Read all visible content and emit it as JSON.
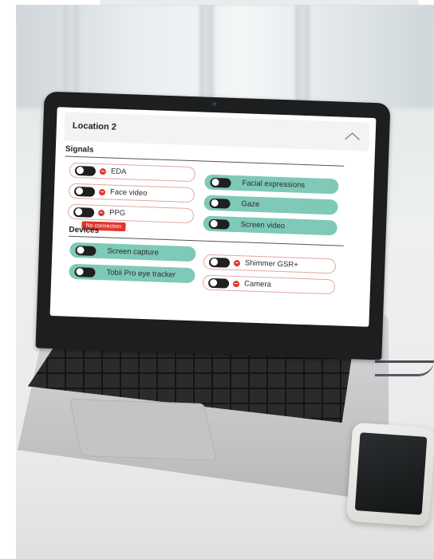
{
  "panel": {
    "title": "Location 2",
    "collapse_icon": "chevron-up-icon"
  },
  "signals": {
    "title": "Signals",
    "items": [
      {
        "label": "EDA",
        "enabled": false,
        "status": "error"
      },
      {
        "label": "Face video",
        "enabled": false,
        "status": "error"
      },
      {
        "label": "PPG",
        "enabled": false,
        "status": "error"
      },
      {
        "label": "Facial expressions",
        "enabled": true
      },
      {
        "label": "Gaze",
        "enabled": true
      },
      {
        "label": "Screen video",
        "enabled": true
      }
    ],
    "tooltip": "No connection"
  },
  "devices": {
    "title": "Devices",
    "items": [
      {
        "label": "Screen capture",
        "enabled": true
      },
      {
        "label": "Tobii Pro eye tracker",
        "enabled": true
      },
      {
        "label": "Shimmer GSR+",
        "enabled": false,
        "status": "error"
      },
      {
        "label": "Camera",
        "enabled": false,
        "status": "error"
      }
    ]
  },
  "colors": {
    "on": "#7ec9b8",
    "off_border": "#e0a7a3",
    "error": "#e2352b",
    "toggle": "#1f1f1f"
  }
}
